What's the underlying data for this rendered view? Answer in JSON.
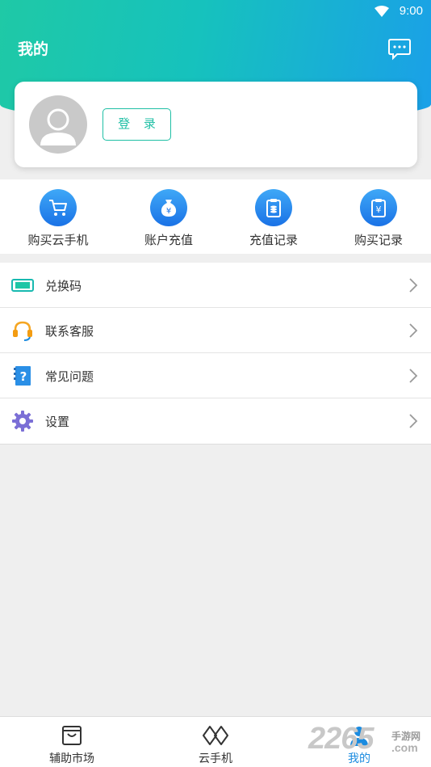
{
  "status_bar": {
    "time": "9:00"
  },
  "header": {
    "title": "我的"
  },
  "profile": {
    "login_label": "登 录"
  },
  "quick_actions": [
    {
      "label": "购买云手机",
      "icon": "cart-icon"
    },
    {
      "label": "账户充值",
      "icon": "money-bag-icon"
    },
    {
      "label": "充值记录",
      "icon": "clipboard-icon"
    },
    {
      "label": "购买记录",
      "icon": "yuan-clipboard-icon"
    }
  ],
  "menu": [
    {
      "label": "兑换码",
      "icon": "card-icon"
    },
    {
      "label": "联系客服",
      "icon": "headset-icon"
    },
    {
      "label": "常见问题",
      "icon": "question-book-icon"
    },
    {
      "label": "设置",
      "icon": "gear-icon"
    }
  ],
  "bottom_nav": [
    {
      "label": "辅助市场",
      "icon": "bag-icon"
    },
    {
      "label": "云手机",
      "icon": "cloud-phone-icon"
    },
    {
      "label": "我的",
      "icon": "profile-icon",
      "active": true
    }
  ],
  "watermark": {
    "number": "2265",
    "text": "手游网",
    "domain": ".com"
  },
  "colors": {
    "accent": "#1fbfa5",
    "active_tab": "#1a8be0",
    "icon_blue": "#1a72e6"
  }
}
